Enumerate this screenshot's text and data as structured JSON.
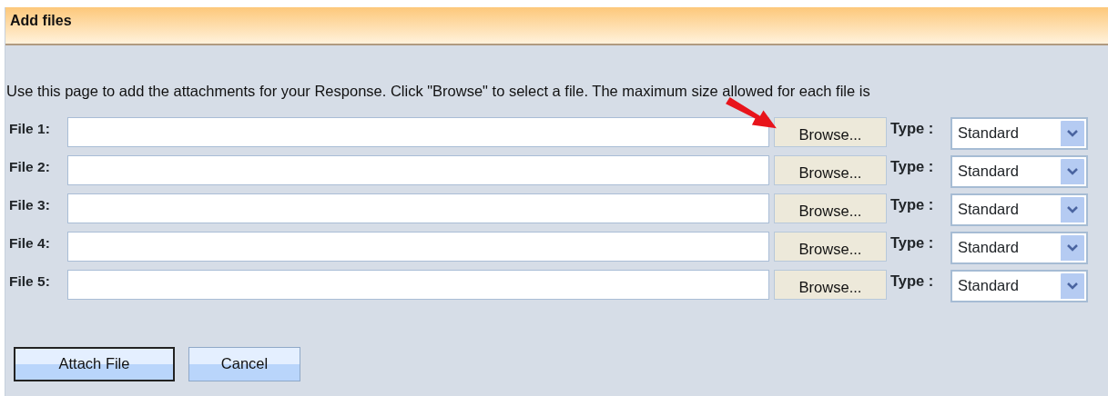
{
  "panel": {
    "title": "Add files"
  },
  "description": "Use this page to add the attachments for your Response. Click \"Browse\" to select a file. The maximum size allowed for each file is",
  "files": [
    {
      "label": "File 1:",
      "browse": "Browse...",
      "type_label": "Type :",
      "type": "Standard",
      "arrow_pointer": true
    },
    {
      "label": "File 2:",
      "browse": "Browse...",
      "type_label": "Type :",
      "type": "Standard",
      "arrow_pointer": false
    },
    {
      "label": "File 3:",
      "browse": "Browse...",
      "type_label": "Type :",
      "type": "Standard",
      "arrow_pointer": false
    },
    {
      "label": "File 4:",
      "browse": "Browse...",
      "type_label": "Type :",
      "type": "Standard",
      "arrow_pointer": false
    },
    {
      "label": "File 5:",
      "browse": "Browse...",
      "type_label": "Type :",
      "type": "Standard",
      "arrow_pointer": false
    }
  ],
  "buttons": [
    {
      "label": "Attach File",
      "focused": true
    },
    {
      "label": "Cancel",
      "focused": false
    }
  ]
}
